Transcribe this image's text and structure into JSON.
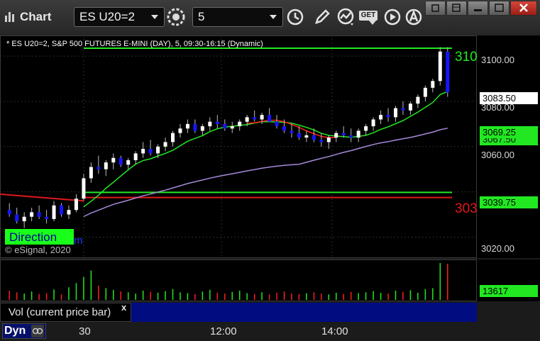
{
  "window": {
    "title": "Chart",
    "symbol_value": "ES U20=2",
    "interval_value": "5",
    "toolbar_get_label": "GET"
  },
  "chart": {
    "legend": "* ES U20=2, S&P 500 FUTURES E-MINI (DAY), 5, 09:30-16:15 (Dynamic)",
    "copyright": "© eSignal, 2020",
    "direction_label": "Direction",
    "direction_tail": "m",
    "price_axis": [
      "3100.00",
      "3080.00",
      "3060.00",
      "3020.00"
    ],
    "partial_price_top": "3100.00",
    "partial_price_bottom": "3039.75",
    "partial_label_top": "310",
    "partial_label_bottom": "303",
    "tags": {
      "last": "3083.50",
      "green_upper": "3069.25",
      "green_lower": "3039.75",
      "hidden_behind": "3067.50"
    },
    "colors": {
      "up": "#ffffff",
      "down": "#1515ff",
      "ma_green": "#22e822",
      "ma_red": "#ff1e1e",
      "ma_purple": "#a58ad8",
      "level_green": "#22e822",
      "level_red": "#e01818"
    }
  },
  "volume": {
    "label": "Vol (current price bar)",
    "close_symbol": "x",
    "last_value": "13617"
  },
  "time_axis": {
    "labels": [
      "30",
      "12:00",
      "14:00"
    ]
  },
  "status": {
    "dyn_label": "Dyn"
  },
  "chart_data": {
    "type": "candlestick",
    "y_range": [
      3012,
      3106
    ],
    "series": [
      {
        "name": "ES U20=2",
        "values": [
          [
            3032,
            3035,
            3029,
            3030
          ],
          [
            3030,
            3033,
            3026,
            3027
          ],
          [
            3027,
            3031,
            3024,
            3029
          ],
          [
            3029,
            3033,
            3027,
            3031
          ],
          [
            3031,
            3034,
            3028,
            3029
          ],
          [
            3029,
            3032,
            3026,
            3028
          ],
          [
            3028,
            3036,
            3027,
            3034
          ],
          [
            3034,
            3035,
            3029,
            3030
          ],
          [
            3030,
            3034,
            3028,
            3032
          ],
          [
            3032,
            3039,
            3031,
            3037
          ],
          [
            3037,
            3048,
            3036,
            3046
          ],
          [
            3046,
            3053,
            3044,
            3051
          ],
          [
            3051,
            3056,
            3048,
            3050
          ],
          [
            3050,
            3054,
            3047,
            3053
          ],
          [
            3053,
            3057,
            3050,
            3055
          ],
          [
            3055,
            3056,
            3051,
            3052
          ],
          [
            3052,
            3055,
            3050,
            3054
          ],
          [
            3054,
            3058,
            3052,
            3057
          ],
          [
            3057,
            3062,
            3055,
            3059
          ],
          [
            3059,
            3063,
            3056,
            3057
          ],
          [
            3057,
            3061,
            3055,
            3060
          ],
          [
            3060,
            3064,
            3058,
            3062
          ],
          [
            3062,
            3067,
            3060,
            3066
          ],
          [
            3066,
            3070,
            3064,
            3068
          ],
          [
            3068,
            3072,
            3066,
            3070
          ],
          [
            3070,
            3072,
            3066,
            3067
          ],
          [
            3067,
            3070,
            3065,
            3069
          ],
          [
            3069,
            3073,
            3067,
            3071
          ],
          [
            3071,
            3074,
            3068,
            3070
          ],
          [
            3070,
            3072,
            3067,
            3068
          ],
          [
            3068,
            3071,
            3066,
            3069
          ],
          [
            3069,
            3072,
            3067,
            3071
          ],
          [
            3071,
            3074,
            3069,
            3073
          ],
          [
            3073,
            3076,
            3071,
            3072
          ],
          [
            3072,
            3075,
            3070,
            3074
          ],
          [
            3074,
            3077,
            3072,
            3071
          ],
          [
            3071,
            3074,
            3068,
            3069
          ],
          [
            3069,
            3072,
            3066,
            3067
          ],
          [
            3067,
            3070,
            3064,
            3066
          ],
          [
            3066,
            3069,
            3063,
            3064
          ],
          [
            3064,
            3067,
            3062,
            3065
          ],
          [
            3065,
            3068,
            3062,
            3063
          ],
          [
            3063,
            3066,
            3060,
            3062
          ],
          [
            3062,
            3065,
            3059,
            3064
          ],
          [
            3064,
            3067,
            3062,
            3066
          ],
          [
            3066,
            3069,
            3064,
            3065
          ],
          [
            3065,
            3068,
            3062,
            3064
          ],
          [
            3064,
            3068,
            3062,
            3067
          ],
          [
            3067,
            3070,
            3065,
            3069
          ],
          [
            3069,
            3073,
            3067,
            3072
          ],
          [
            3072,
            3076,
            3070,
            3074
          ],
          [
            3074,
            3077,
            3071,
            3073
          ],
          [
            3073,
            3078,
            3071,
            3077
          ],
          [
            3077,
            3080,
            3074,
            3076
          ],
          [
            3076,
            3080,
            3074,
            3079
          ],
          [
            3079,
            3083,
            3077,
            3082
          ],
          [
            3082,
            3087,
            3080,
            3086
          ],
          [
            3086,
            3090,
            3084,
            3089
          ],
          [
            3089,
            3104,
            3087,
            3102
          ],
          [
            3102,
            3104,
            3082,
            3084
          ]
        ]
      }
    ],
    "levels": [
      {
        "value": 3103.5,
        "color": "green"
      },
      {
        "value": 3039.75,
        "color": "green"
      },
      {
        "value": 3037.5,
        "color": "red"
      }
    ],
    "volume": [
      22,
      18,
      15,
      20,
      14,
      16,
      25,
      13,
      30,
      40,
      55,
      70,
      34,
      28,
      24,
      20,
      18,
      15,
      22,
      19,
      17,
      21,
      26,
      18,
      16,
      14,
      20,
      24,
      17,
      15,
      19,
      22,
      16,
      14,
      18,
      13,
      17,
      20,
      15,
      14,
      16,
      18,
      15,
      13,
      17,
      14,
      19,
      16,
      18,
      21,
      17,
      15,
      22,
      19,
      23,
      17,
      26,
      28,
      88,
      86
    ]
  }
}
